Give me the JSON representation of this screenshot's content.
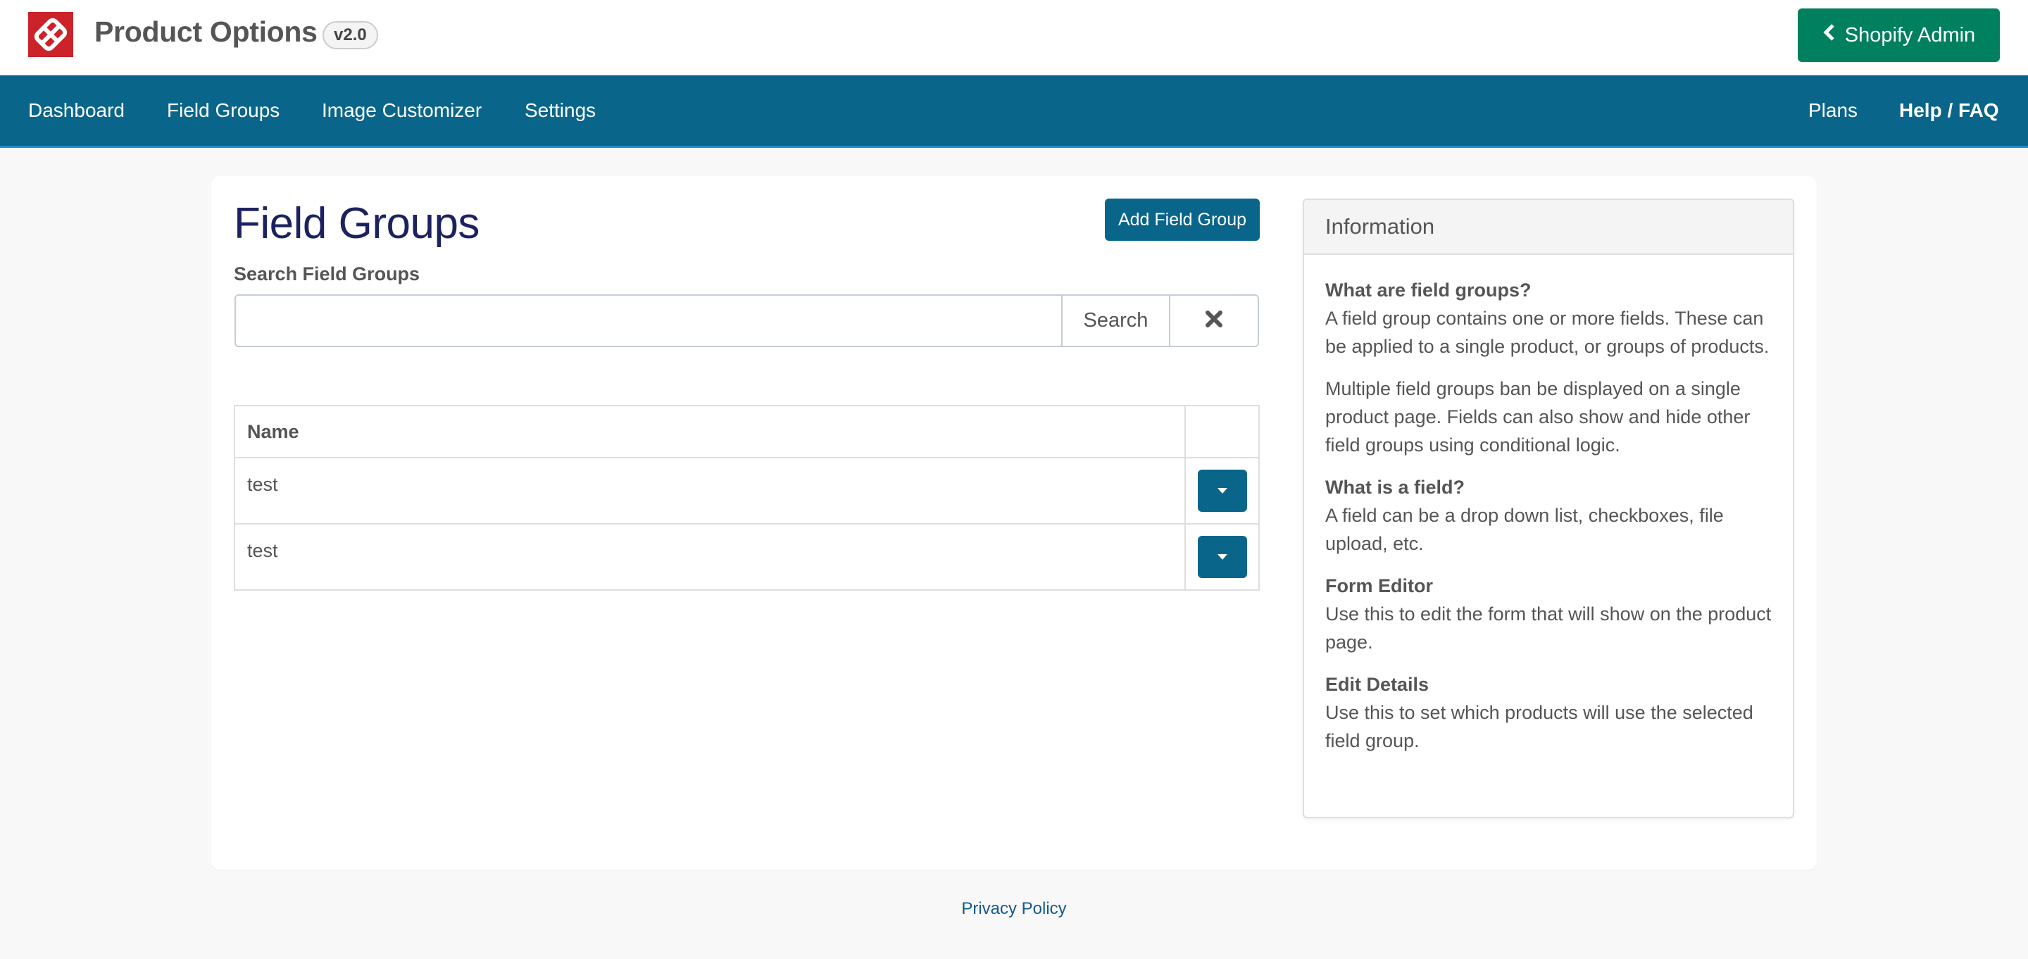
{
  "header": {
    "app_title": "Product Options",
    "version": "v2.0",
    "shopify_admin_label": "Shopify Admin",
    "logo_icon": "app-logo-icon"
  },
  "nav": {
    "left": [
      {
        "label": "Dashboard"
      },
      {
        "label": "Field Groups"
      },
      {
        "label": "Image Customizer"
      },
      {
        "label": "Settings"
      }
    ],
    "right": [
      {
        "label": "Plans"
      },
      {
        "label": "Help / FAQ"
      }
    ]
  },
  "main": {
    "title": "Field Groups",
    "add_button_label": "Add Field Group",
    "search": {
      "label": "Search Field Groups",
      "value": "",
      "placeholder": "",
      "search_button_label": "Search",
      "clear_icon": "times-icon"
    },
    "table": {
      "columns": [
        "Name",
        ""
      ],
      "rows": [
        {
          "name": "test"
        },
        {
          "name": "test"
        }
      ]
    }
  },
  "info": {
    "title": "Information",
    "sections": [
      {
        "heading": "What are field groups?",
        "paragraphs": [
          "A field group contains one or more fields. These can be applied to a single product, or groups of products.",
          "Multiple field groups ban be displayed on a single product page. Fields can also show and hide other field groups using conditional logic."
        ]
      },
      {
        "heading": "What is a field?",
        "paragraphs": [
          "A field can be a drop down list, checkboxes, file upload, etc."
        ]
      },
      {
        "heading": "Form Editor",
        "paragraphs": [
          "Use this to edit the form that will show on the product page."
        ]
      },
      {
        "heading": "Edit Details",
        "paragraphs": [
          "Use this to set which products will use the selected field group."
        ]
      }
    ]
  },
  "footer": {
    "privacy_label": "Privacy Policy"
  },
  "colors": {
    "primary": "#0a658b",
    "shopify_green": "#00805f",
    "logo_red": "#cc2229",
    "title_navy": "#1c2260",
    "link": "#155a8a"
  }
}
